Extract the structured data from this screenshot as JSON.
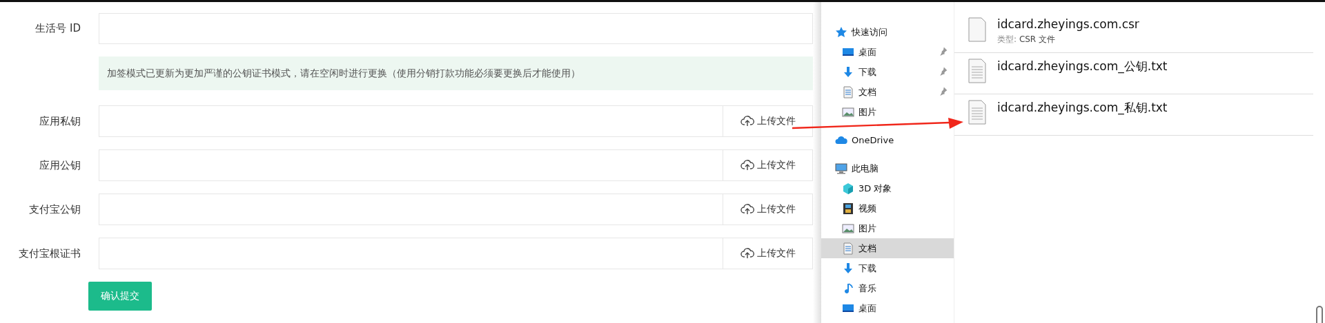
{
  "form": {
    "rows": [
      {
        "kind": "input",
        "label": "生活号 ID"
      },
      {
        "kind": "notice",
        "text": "加签模式已更新为更加严谨的公钥证书模式，请在空闲时进行更换（使用分销打款功能必须要更换后才能使用）"
      },
      {
        "kind": "upload",
        "label": "应用私钥",
        "button": "上传文件"
      },
      {
        "kind": "upload",
        "label": "应用公钥",
        "button": "上传文件"
      },
      {
        "kind": "upload",
        "label": "支付宝公钥",
        "button": "上传文件"
      },
      {
        "kind": "upload",
        "label": "支付宝根证书",
        "button": "上传文件"
      }
    ],
    "submit": "确认提交"
  },
  "explorer": {
    "sidebar": [
      {
        "label": "快速访问",
        "selected": false,
        "children": [
          {
            "label": "桌面",
            "selected": false,
            "pinned": true
          },
          {
            "label": "下载",
            "selected": false,
            "pinned": true
          },
          {
            "label": "文档",
            "selected": false,
            "pinned": true
          },
          {
            "label": "图片",
            "selected": false,
            "pinned": false
          }
        ]
      },
      {
        "label": "OneDrive",
        "selected": false
      },
      {
        "label": "此电脑",
        "selected": false,
        "children": [
          {
            "label": "3D 对象",
            "selected": false
          },
          {
            "label": "视频",
            "selected": false
          },
          {
            "label": "图片",
            "selected": false
          },
          {
            "label": "文档",
            "selected": true
          },
          {
            "label": "下载",
            "selected": false
          },
          {
            "label": "音乐",
            "selected": false
          },
          {
            "label": "桌面",
            "selected": false
          }
        ]
      }
    ],
    "files": [
      {
        "kind": "blank",
        "name": "idcard.zheyings.com.csr",
        "type_label": "类型:",
        "type": "CSR 文件"
      },
      {
        "kind": "text",
        "name": "idcard.zheyings.com_公钥.txt"
      },
      {
        "kind": "text",
        "name": "idcard.zheyings.com_私钥.txt"
      }
    ]
  }
}
